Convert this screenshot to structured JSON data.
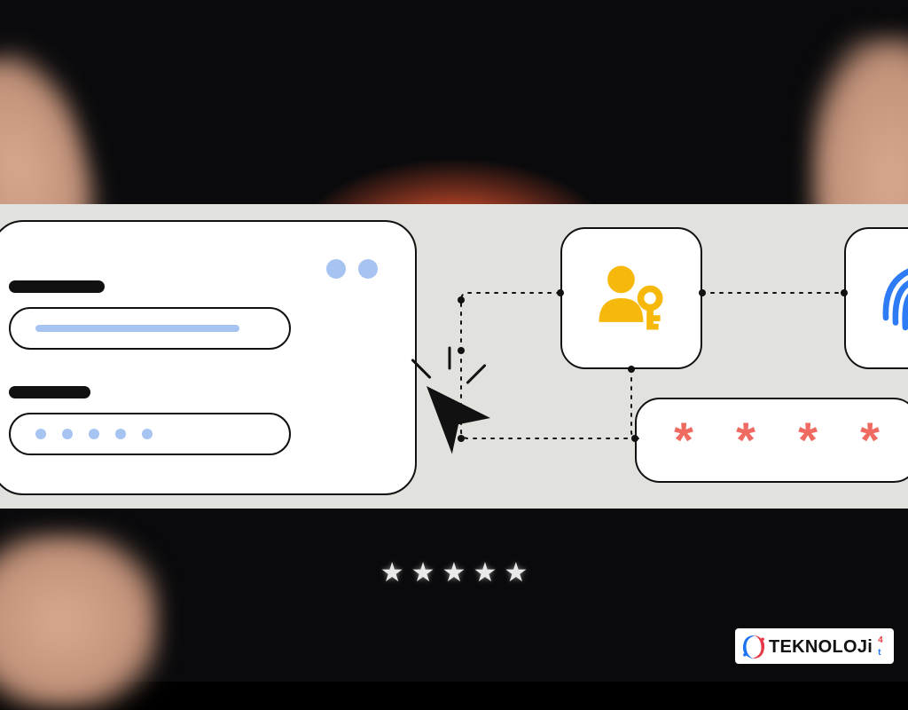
{
  "illustration": {
    "login_card": {
      "username_label": "",
      "password_label": "",
      "password_dot_count": 5
    },
    "password_tile": {
      "asterisks": [
        "*",
        "*",
        "*",
        "*"
      ]
    },
    "icons": {
      "user_key": "user-key-icon",
      "fingerprint": "fingerprint-icon",
      "cursor": "cursor-click-icon"
    }
  },
  "stars": {
    "count": 5,
    "glyph": "★"
  },
  "brand": {
    "name": "TEKNOLOJi",
    "suffix_top": "4",
    "suffix_bottom": "t",
    "colors": {
      "swirl_red": "#e63946",
      "swirl_blue": "#1d72f2"
    }
  }
}
